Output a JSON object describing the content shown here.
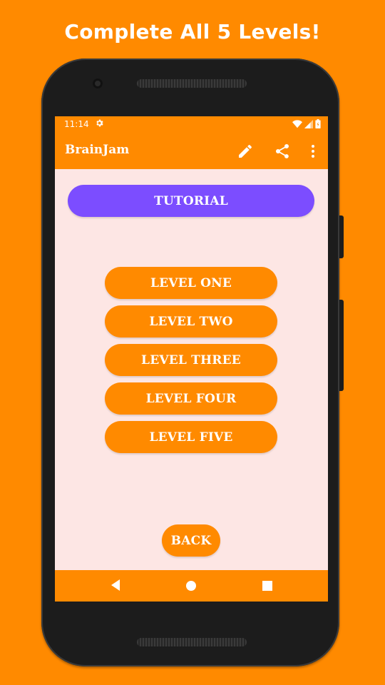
{
  "promo": {
    "headline": "Complete All 5 Levels!"
  },
  "status_bar": {
    "time": "11:14",
    "icons": [
      "settings-gear-icon",
      "wifi-icon",
      "cell-signal-icon",
      "battery-icon"
    ]
  },
  "app_bar": {
    "title": "BrainJam",
    "actions": [
      "edit-pencil-icon",
      "share-icon",
      "more-vert-icon"
    ]
  },
  "main": {
    "tutorial_label": "TUTORIAL",
    "levels": [
      "LEVEL ONE",
      "LEVEL TWO",
      "LEVEL THREE",
      "LEVEL FOUR",
      "LEVEL FIVE"
    ],
    "back_label": "BACK"
  },
  "nav_bar": {
    "icons": [
      "back-triangle-icon",
      "home-circle-icon",
      "recents-square-icon"
    ]
  },
  "colors": {
    "background": "#ff8a00",
    "accent_orange": "#ff8a00",
    "tutorial_purple": "#7c4dff",
    "screen_background": "#fde6e4",
    "text_white": "#ffffff"
  }
}
